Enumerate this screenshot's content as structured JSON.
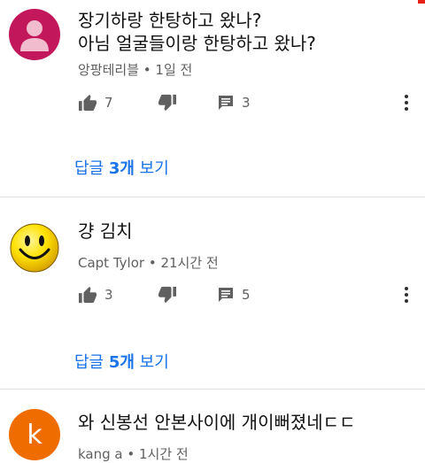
{
  "comments": [
    {
      "text": "장기하랑 한탕하고 왔나?\n아님 얼굴들이랑 한탕하고 왔나?",
      "author": "앙팡테리블",
      "time": "1일 전",
      "likes": "7",
      "replies_count": "3",
      "reply_link_prefix": "답글 ",
      "reply_link_count": "3개",
      "reply_link_suffix": " 보기",
      "avatar": "person-avatar-icon"
    },
    {
      "text": "걍 김치",
      "author": "Capt Tylor",
      "time": "21시간 전",
      "likes": "3",
      "replies_count": "5",
      "reply_link_prefix": "답글 ",
      "reply_link_count": "5개",
      "reply_link_suffix": " 보기",
      "avatar": "smiley-avatar-icon"
    },
    {
      "text": "와 신봉선 안본사이에 개이뻐졌네ㄷㄷ",
      "author": "kang a",
      "time": "1시간 전",
      "avatar_letter": "k"
    }
  ],
  "meta_separator": " • ",
  "colors": {
    "link": "#1a73e8",
    "meta": "#606060",
    "avatar1": "#c2185b",
    "avatar3": "#ef6c00"
  }
}
